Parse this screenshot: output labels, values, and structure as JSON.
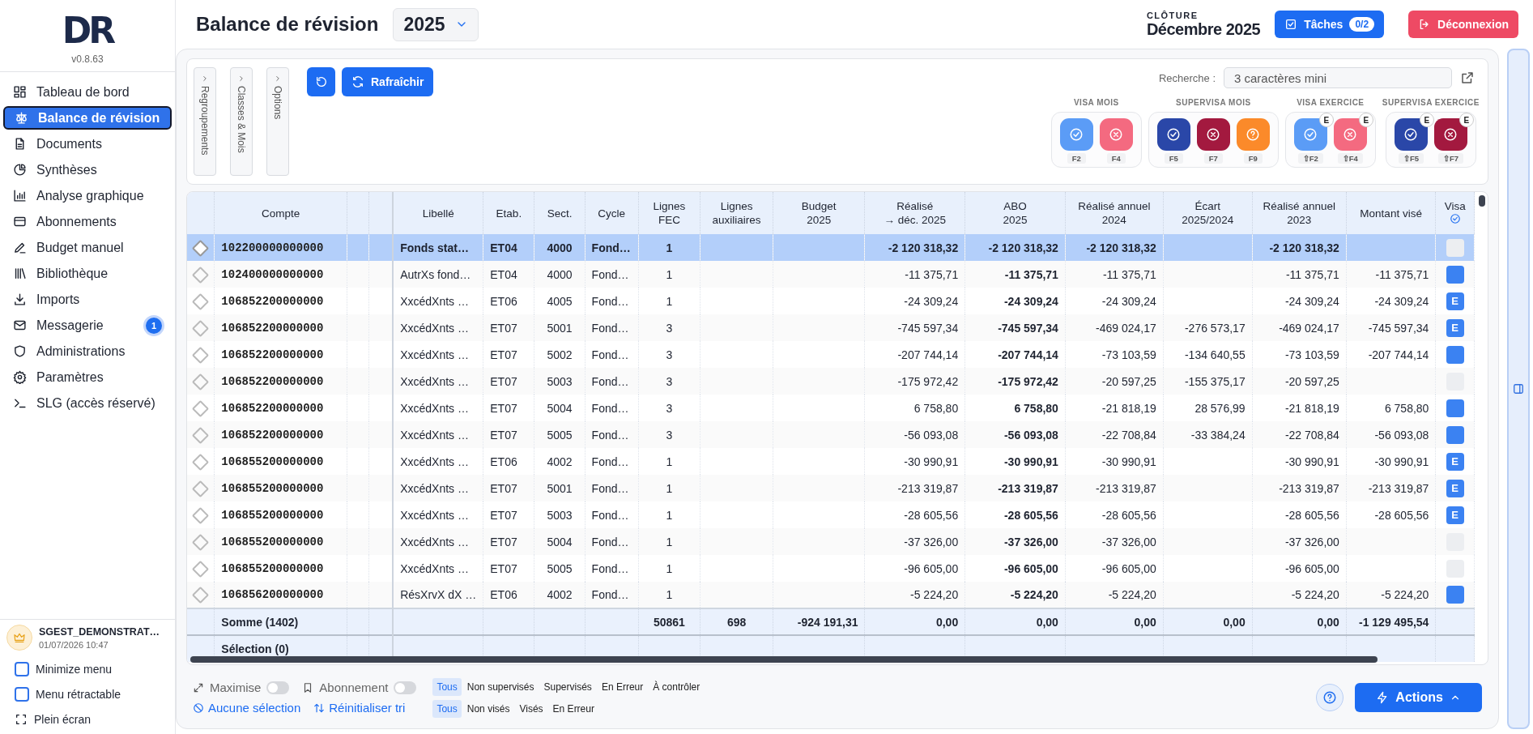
{
  "sidebar": {
    "logo": "DR",
    "version": "v0.8.63",
    "items": [
      {
        "label": "Tableau de bord",
        "selected": false
      },
      {
        "label": "Balance de révision",
        "selected": true
      },
      {
        "label": "Documents",
        "selected": false
      },
      {
        "label": "Synthèses",
        "selected": false
      },
      {
        "label": "Analyse graphique",
        "selected": false
      },
      {
        "label": "Abonnements",
        "selected": false
      },
      {
        "label": "Budget manuel",
        "selected": false
      },
      {
        "label": "Bibliothèque",
        "selected": false
      },
      {
        "label": "Imports",
        "selected": false
      },
      {
        "label": "Messagerie",
        "selected": false,
        "badge": "1"
      },
      {
        "label": "Administrations",
        "selected": false
      },
      {
        "label": "Paramètres",
        "selected": false
      },
      {
        "label": "SLG (accès réservé)",
        "selected": false
      }
    ],
    "user": {
      "name": "SGEST_DEMONSTRAT…",
      "date": "01/07/2026 10:47"
    },
    "options": [
      {
        "label": "Minimize menu",
        "checked": false
      },
      {
        "label": "Menu rétractable",
        "checked": false
      }
    ],
    "fullscreen": "Plein écran"
  },
  "header": {
    "title": "Balance de révision",
    "year": "2025",
    "closing_label": "CLÔTURE",
    "closing_value": "Décembre 2025",
    "tasks_button": "Tâches",
    "tasks_count": "0/2",
    "logout_button": "Déconnexion"
  },
  "toolbar": {
    "side_tabs": [
      "Regroupements",
      "Classes & Mois",
      "Options"
    ],
    "refresh_button": "Rafraîchir",
    "search_label": "Recherche :",
    "search_placeholder": "3 caractères mini",
    "visa_groups": [
      {
        "title": "VISA MOIS",
        "buttons": [
          {
            "kind": "check",
            "color": "#5b9cf6",
            "key": "F2"
          },
          {
            "kind": "cross",
            "color": "#f46a80",
            "key": "F4"
          }
        ]
      },
      {
        "title": "SUPERVISA MOIS",
        "buttons": [
          {
            "kind": "check",
            "color": "#2a47a8",
            "key": "F5"
          },
          {
            "kind": "cross",
            "color": "#a3193f",
            "key": "F7"
          },
          {
            "kind": "question",
            "color": "#fb8a2a",
            "key": "F9"
          }
        ]
      },
      {
        "title": "VISA EXERCICE",
        "buttons": [
          {
            "kind": "check",
            "color": "#5b9cf6",
            "key": "⇧F2",
            "badge": "E"
          },
          {
            "kind": "cross",
            "color": "#f46a80",
            "key": "⇧F4",
            "badge": "E"
          }
        ]
      },
      {
        "title": "SUPERVISA EXERCICE",
        "buttons": [
          {
            "kind": "check",
            "color": "#2a47a8",
            "key": "⇧F5",
            "badge": "E"
          },
          {
            "kind": "cross",
            "color": "#a3193f",
            "key": "⇧F7",
            "badge": "E"
          }
        ]
      }
    ]
  },
  "table": {
    "columns": [
      "Compte",
      "Libellé",
      "Etab.",
      "Sect.",
      "Cycle",
      "Lignes\nFEC",
      "Lignes\nauxiliaires",
      "Budget\n2025",
      "Réalisé\n→ déc. 2025",
      "ABO\n2025",
      "Réalisé annuel\n2024",
      "Écart\n2025/2024",
      "Réalisé annuel\n2023",
      "Montant visé",
      "Visa"
    ],
    "rows": [
      {
        "selected": true,
        "checked": false,
        "compte": "102200000000000",
        "libelle": "Fonds stat…",
        "etab": "ET04",
        "sect": "4000",
        "cycle": "Fond…",
        "fec": "1",
        "realise": "-2 120 318,32",
        "abo": "-2 120 318,32",
        "ra2024": "-2 120 318,32",
        "ra2023": "-2 120 318,32"
      },
      {
        "selected": false,
        "checked": true,
        "compte": "102400000000000",
        "libelle": "AutrXs fond…",
        "etab": "ET04",
        "sect": "4000",
        "cycle": "Fond…",
        "fec": "1",
        "realise": "-11 375,71",
        "abo": "-11 375,71",
        "ra2024": "-11 375,71",
        "ra2023": "-11 375,71",
        "vise": "-11 375,71"
      },
      {
        "selected": false,
        "checked": true,
        "visa_label": "E",
        "compte": "106852200000000",
        "libelle": "XxcédXnts …",
        "etab": "ET06",
        "sect": "4005",
        "cycle": "Fond…",
        "fec": "1",
        "realise": "-24 309,24",
        "abo": "-24 309,24",
        "ra2024": "-24 309,24",
        "ra2023": "-24 309,24",
        "vise": "-24 309,24"
      },
      {
        "selected": false,
        "checked": true,
        "visa_label": "E",
        "compte": "106852200000000",
        "libelle": "XxcédXnts …",
        "etab": "ET07",
        "sect": "5001",
        "cycle": "Fond…",
        "fec": "3",
        "realise": "-745 597,34",
        "abo": "-745 597,34",
        "ra2024": "-469 024,17",
        "ecart": "-276 573,17",
        "ra2023": "-469 024,17",
        "vise": "-745 597,34"
      },
      {
        "selected": false,
        "checked": true,
        "compte": "106852200000000",
        "libelle": "XxcédXnts …",
        "etab": "ET07",
        "sect": "5002",
        "cycle": "Fond…",
        "fec": "3",
        "realise": "-207 744,14",
        "abo": "-207 744,14",
        "ra2024": "-73 103,59",
        "ecart": "-134 640,55",
        "ra2023": "-73 103,59",
        "vise": "-207 744,14"
      },
      {
        "selected": false,
        "checked": false,
        "compte": "106852200000000",
        "libelle": "XxcédXnts …",
        "etab": "ET07",
        "sect": "5003",
        "cycle": "Fond…",
        "fec": "3",
        "realise": "-175 972,42",
        "abo": "-175 972,42",
        "ra2024": "-20 597,25",
        "ecart": "-155 375,17",
        "ra2023": "-20 597,25"
      },
      {
        "selected": false,
        "checked": true,
        "compte": "106852200000000",
        "libelle": "XxcédXnts …",
        "etab": "ET07",
        "sect": "5004",
        "cycle": "Fond…",
        "fec": "3",
        "realise": "6 758,80",
        "abo": "6 758,80",
        "ra2024": "-21 818,19",
        "ecart": "28 576,99",
        "ra2023": "-21 818,19",
        "vise": "6 758,80"
      },
      {
        "selected": false,
        "checked": true,
        "compte": "106852200000000",
        "libelle": "XxcédXnts …",
        "etab": "ET07",
        "sect": "5005",
        "cycle": "Fond…",
        "fec": "3",
        "realise": "-56 093,08",
        "abo": "-56 093,08",
        "ra2024": "-22 708,84",
        "ecart": "-33 384,24",
        "ra2023": "-22 708,84",
        "vise": "-56 093,08"
      },
      {
        "selected": false,
        "checked": true,
        "visa_label": "E",
        "compte": "106855200000000",
        "libelle": "XxcédXnts …",
        "etab": "ET06",
        "sect": "4002",
        "cycle": "Fond…",
        "fec": "1",
        "realise": "-30 990,91",
        "abo": "-30 990,91",
        "ra2024": "-30 990,91",
        "ra2023": "-30 990,91",
        "vise": "-30 990,91"
      },
      {
        "selected": false,
        "checked": true,
        "visa_label": "E",
        "compte": "106855200000000",
        "libelle": "XxcédXnts …",
        "etab": "ET07",
        "sect": "5001",
        "cycle": "Fond…",
        "fec": "1",
        "realise": "-213 319,87",
        "abo": "-213 319,87",
        "ra2024": "-213 319,87",
        "ra2023": "-213 319,87",
        "vise": "-213 319,87"
      },
      {
        "selected": false,
        "checked": true,
        "visa_label": "E",
        "compte": "106855200000000",
        "libelle": "XxcédXnts …",
        "etab": "ET07",
        "sect": "5003",
        "cycle": "Fond…",
        "fec": "1",
        "realise": "-28 605,56",
        "abo": "-28 605,56",
        "ra2024": "-28 605,56",
        "ra2023": "-28 605,56",
        "vise": "-28 605,56"
      },
      {
        "selected": false,
        "checked": false,
        "compte": "106855200000000",
        "libelle": "XxcédXnts …",
        "etab": "ET07",
        "sect": "5004",
        "cycle": "Fond…",
        "fec": "1",
        "realise": "-37 326,00",
        "abo": "-37 326,00",
        "ra2024": "-37 326,00",
        "ra2023": "-37 326,00"
      },
      {
        "selected": false,
        "checked": false,
        "compte": "106855200000000",
        "libelle": "XxcédXnts …",
        "etab": "ET07",
        "sect": "5005",
        "cycle": "Fond…",
        "fec": "1",
        "realise": "-96 605,00",
        "abo": "-96 605,00",
        "ra2024": "-96 605,00",
        "ra2023": "-96 605,00"
      },
      {
        "selected": false,
        "checked": true,
        "compte": "106856200000000",
        "libelle": "RésXrvX dX …",
        "etab": "ET06",
        "sect": "4002",
        "cycle": "Fond…",
        "fec": "1",
        "realise": "-5 224,20",
        "abo": "-5 224,20",
        "ra2024": "-5 224,20",
        "ra2023": "-5 224,20",
        "vise": "-5 224,20"
      }
    ],
    "sum_row": {
      "label": "Somme (1402)",
      "fec": "50861",
      "aux": "698",
      "budget": "-924 191,31",
      "realise": "0,00",
      "abo": "0,00",
      "ra2024": "0,00",
      "ecart": "0,00",
      "ra2023": "0,00",
      "vise": "-1 129 495,54"
    },
    "selection_row": {
      "label": "Sélection (0)"
    }
  },
  "footer": {
    "toggles": [
      {
        "label": "Maximise",
        "on": false
      },
      {
        "label": "Abonnement",
        "on": false
      }
    ],
    "links": [
      "Aucune sélection",
      "Réinitialiser tri"
    ],
    "filters": [
      [
        {
          "label": "Tous",
          "selected": true
        },
        {
          "label": "Non supervisés",
          "selected": false
        },
        {
          "label": "Supervisés",
          "selected": false
        },
        {
          "label": "En Erreur",
          "selected": false
        },
        {
          "label": "À contrôler",
          "selected": false
        }
      ],
      [
        {
          "label": "Tous",
          "selected": true
        },
        {
          "label": "Non visés",
          "selected": false
        },
        {
          "label": "Visés",
          "selected": false
        },
        {
          "label": "En Erreur",
          "selected": false
        }
      ]
    ],
    "actions_button": "Actions"
  }
}
